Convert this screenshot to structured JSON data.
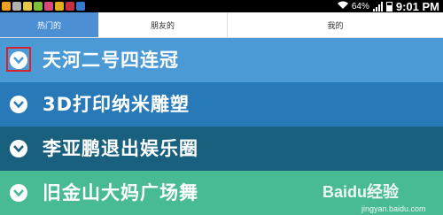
{
  "status_bar": {
    "notification_icons": [
      "notification-icon-1",
      "notification-icon-2",
      "notification-icon-3",
      "notification-icon-4",
      "notification-icon-5",
      "notification-icon-6",
      "notification-icon-7",
      "notification-icon-8"
    ],
    "battery_percent": "64%",
    "battery_level": 0.64,
    "time": "9:01 PM"
  },
  "tabs": [
    {
      "label": "热门的",
      "selected": true
    },
    {
      "label": "朋友的",
      "selected": false
    },
    {
      "label": "我的",
      "selected": false
    }
  ],
  "news": [
    {
      "title": "天河二号四连冠",
      "color": "#4b9ad6"
    },
    {
      "title": "3D打印纳米雕塑",
      "color": "#2879b8"
    },
    {
      "title": "李亚鹏退出娱乐圈",
      "color": "#18607e"
    },
    {
      "title": "旧金山大妈广场舞",
      "color": "#48ba94"
    }
  ],
  "colors": {
    "tab_selected": "#4c8fd3",
    "highlight": "#d6242a"
  },
  "watermark": {
    "brand": "Baidu经验",
    "site": "jingyan.baidu.com"
  }
}
